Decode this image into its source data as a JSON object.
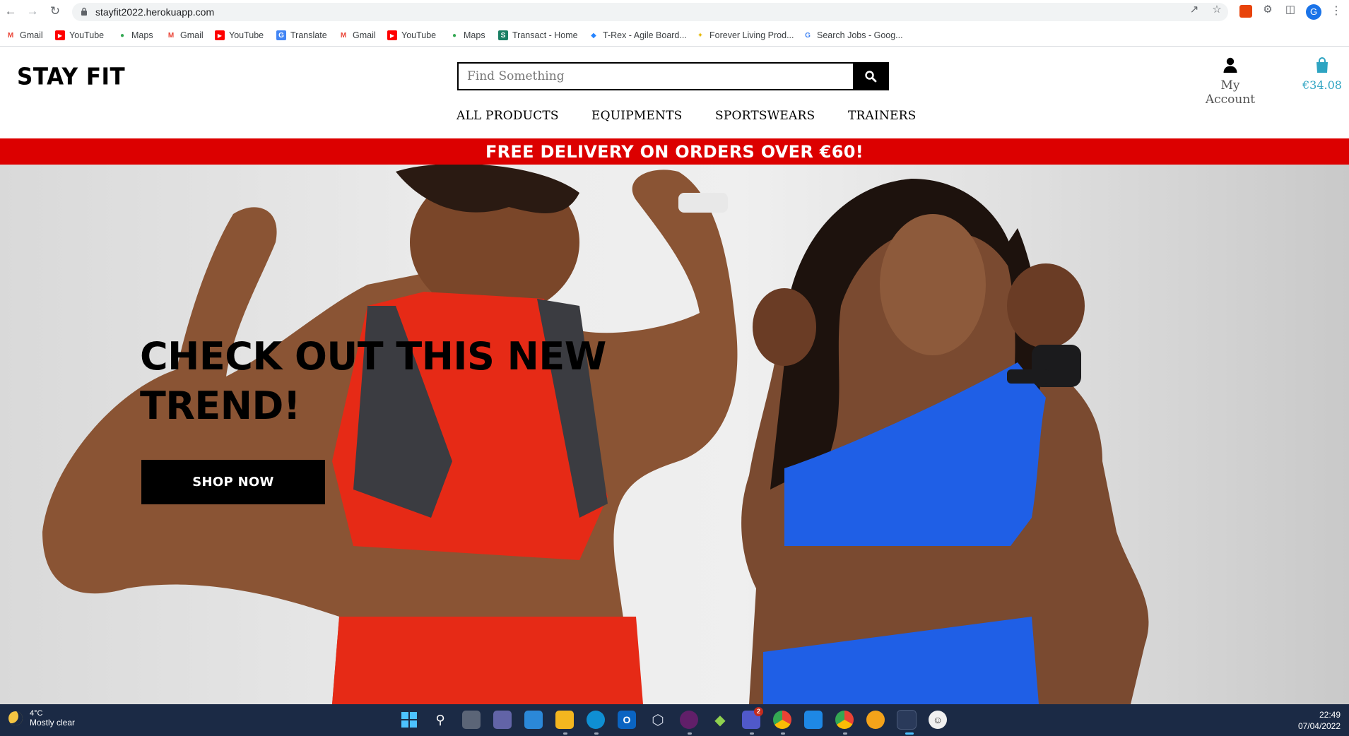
{
  "browser": {
    "url": "stayfit2022.herokuapp.com",
    "profile_initial": "G",
    "bookmarks": [
      {
        "label": "Gmail",
        "icon": "gmail-icon"
      },
      {
        "label": "YouTube",
        "icon": "youtube-icon"
      },
      {
        "label": "Maps",
        "icon": "maps-icon"
      },
      {
        "label": "Gmail",
        "icon": "gmail-icon"
      },
      {
        "label": "YouTube",
        "icon": "youtube-icon"
      },
      {
        "label": "Translate",
        "icon": "translate-icon"
      },
      {
        "label": "Gmail",
        "icon": "gmail-icon"
      },
      {
        "label": "YouTube",
        "icon": "youtube-icon"
      },
      {
        "label": "Maps",
        "icon": "maps-icon"
      },
      {
        "label": "Transact - Home",
        "icon": "transact-icon"
      },
      {
        "label": "T-Rex - Agile Board...",
        "icon": "jira-icon"
      },
      {
        "label": "Forever Living Prod...",
        "icon": "forever-living-icon"
      },
      {
        "label": "Search Jobs - Goog...",
        "icon": "google-icon"
      }
    ]
  },
  "site": {
    "logo": "STAY FIT",
    "search_placeholder": "Find Something",
    "account_label": "My Account",
    "bag_total": "€34.08",
    "nav": [
      "ALL PRODUCTS",
      "EQUIPMENTS",
      "SPORTSWEARS",
      "TRAINERS"
    ],
    "promo": "FREE DELIVERY ON ORDERS OVER €60!",
    "accent_color": "#2ea4c2",
    "promo_color": "#dc0000"
  },
  "hero": {
    "headline_line1": "CHECK OUT THIS NEW",
    "headline_line2": "TREND!",
    "cta": "SHOP NOW"
  },
  "taskbar": {
    "temperature": "4°C",
    "weather": "Mostly clear",
    "time": "22:49",
    "date": "07/04/2022",
    "teams_badge": "2"
  }
}
